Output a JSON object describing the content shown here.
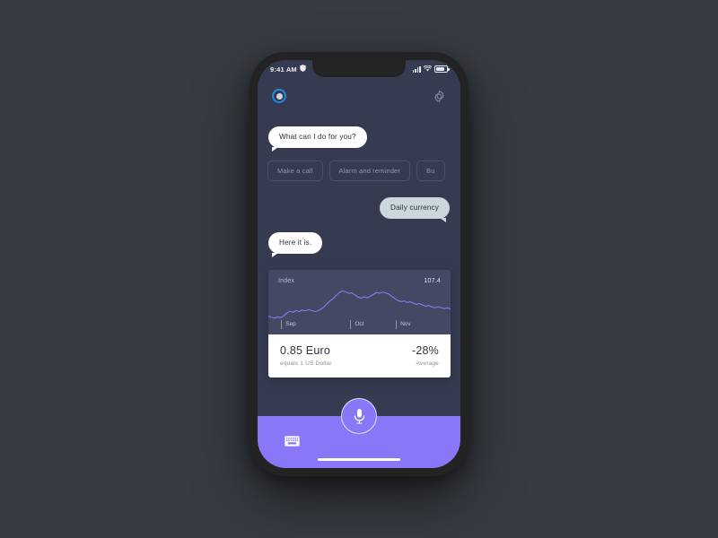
{
  "canvas": {
    "background": "#383c42"
  },
  "device": {
    "frame_color": "#232323",
    "screen_background": "#373b52"
  },
  "status_bar": {
    "time": "9:41 AM",
    "location_icon": "location-icon",
    "signal_icon": "signal-bars-icon",
    "wifi_icon": "wifi-icon",
    "battery_icon": "battery-icon"
  },
  "header": {
    "assistant_orb_icon": "assistant-orb-icon",
    "assistant_orb_color": "#1f8ae0",
    "settings_icon": "gear-icon"
  },
  "conversation": {
    "greeting": "What can I do for  you?",
    "user_request": "Daily currency",
    "assistant_reply": "Here it is.",
    "suggestions": [
      {
        "label": "Make a call"
      },
      {
        "label": "Alarm and reminder"
      },
      {
        "label": "Bu"
      }
    ]
  },
  "currency_card": {
    "chart_title": "Index",
    "chart_value": "107.4",
    "rate_value": "0.85 Euro",
    "rate_caption": "equals 1 US Dollar",
    "change_value": "-28%",
    "change_caption": "Average",
    "line_color": "#8878f7",
    "panel_color": "#434863"
  },
  "bottom_bar": {
    "color": "#8878f7",
    "keyboard_icon": "keyboard-icon",
    "mic_icon": "microphone-icon",
    "home_indicator": "home-indicator"
  },
  "chart_data": {
    "type": "line",
    "title": "Index",
    "xlabel": "",
    "ylabel": "Index",
    "categories": [
      "Sep",
      "Oct",
      "Nov"
    ],
    "tick_positions_pct": [
      7,
      45,
      70
    ],
    "x": [
      0,
      1,
      2,
      3,
      4,
      5,
      6,
      7,
      8,
      9,
      10,
      11,
      12,
      13,
      14,
      15,
      16,
      17,
      18,
      19,
      20,
      21,
      22,
      23,
      24,
      25,
      26,
      27,
      28,
      29,
      30,
      31,
      32,
      33,
      34,
      35,
      36,
      37,
      38,
      39,
      40,
      41,
      42,
      43,
      44,
      45,
      46,
      47,
      48,
      49,
      50,
      51,
      52,
      53,
      54,
      55,
      56,
      57,
      58,
      59
    ],
    "values": [
      100.8,
      100.5,
      100.3,
      100.6,
      100.4,
      100.9,
      101.6,
      102.1,
      101.8,
      102.3,
      102.0,
      102.4,
      102.2,
      102.5,
      102.3,
      102.0,
      102.2,
      102.6,
      103.2,
      104.1,
      104.8,
      105.4,
      106.3,
      107.0,
      107.4,
      107.2,
      106.8,
      106.9,
      106.4,
      105.8,
      105.5,
      105.9,
      105.6,
      106.0,
      106.5,
      107.0,
      106.8,
      107.1,
      106.9,
      106.6,
      106.0,
      105.4,
      104.9,
      104.6,
      104.8,
      104.4,
      104.6,
      104.2,
      103.9,
      104.1,
      103.7,
      103.4,
      103.6,
      103.2,
      103.0,
      103.3,
      103.0,
      102.8,
      103.0,
      102.7
    ],
    "ylim": [
      100.0,
      108.0
    ],
    "grid": false,
    "legend": false,
    "value_label": "107.4"
  }
}
